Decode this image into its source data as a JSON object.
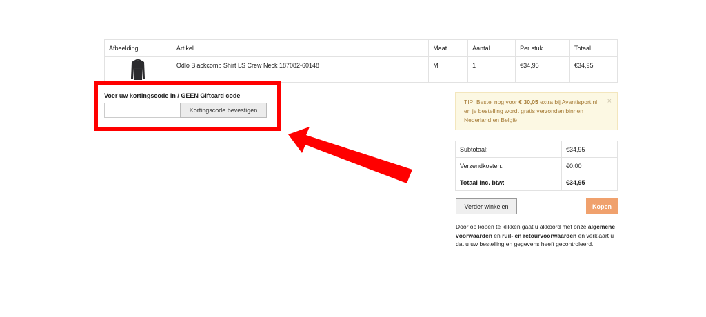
{
  "cart": {
    "headers": [
      "Afbeelding",
      "Artikel",
      "Maat",
      "Aantal",
      "Per stuk",
      "Totaal"
    ],
    "rows": [
      {
        "article": "Odlo Blackcomb Shirt LS Crew Neck 187082-60148",
        "size": "M",
        "quantity": "1",
        "unit_price": "€34,95",
        "total": "€34,95",
        "image_icon": "shirt-icon"
      }
    ]
  },
  "discount": {
    "label": "Voer uw kortingscode in / GEEN Giftcard code",
    "input_value": "",
    "button_label": "Kortingscode bevestigen",
    "highlight_color": "#ff0000"
  },
  "tip": {
    "prefix": "TIP: Bestel nog voor ",
    "amount": "€ 30,05",
    "suffix": " extra bij Avantisport.nl en je bestelling wordt gratis verzonden binnen Nederland en België",
    "close_label": "×"
  },
  "totals": [
    {
      "label": "Subtotaal:",
      "value": "€34,95"
    },
    {
      "label": "Verzendkosten:",
      "value": "€0,00"
    },
    {
      "label": "Totaal inc. btw:",
      "value": "€34,95"
    }
  ],
  "actions": {
    "continue_label": "Verder winkelen",
    "buy_label": "Kopen",
    "buy_color": "#f0a16d"
  },
  "terms": {
    "part1": "Door op kopen te klikken gaat u akkoord met onze ",
    "link1": "algemene voorwaarden",
    "part2": " en ",
    "link2": "ruil- en retourvoorwaarden",
    "part3": " en verklaart u dat u uw bestelling en gegevens heeft gecontroleerd."
  }
}
